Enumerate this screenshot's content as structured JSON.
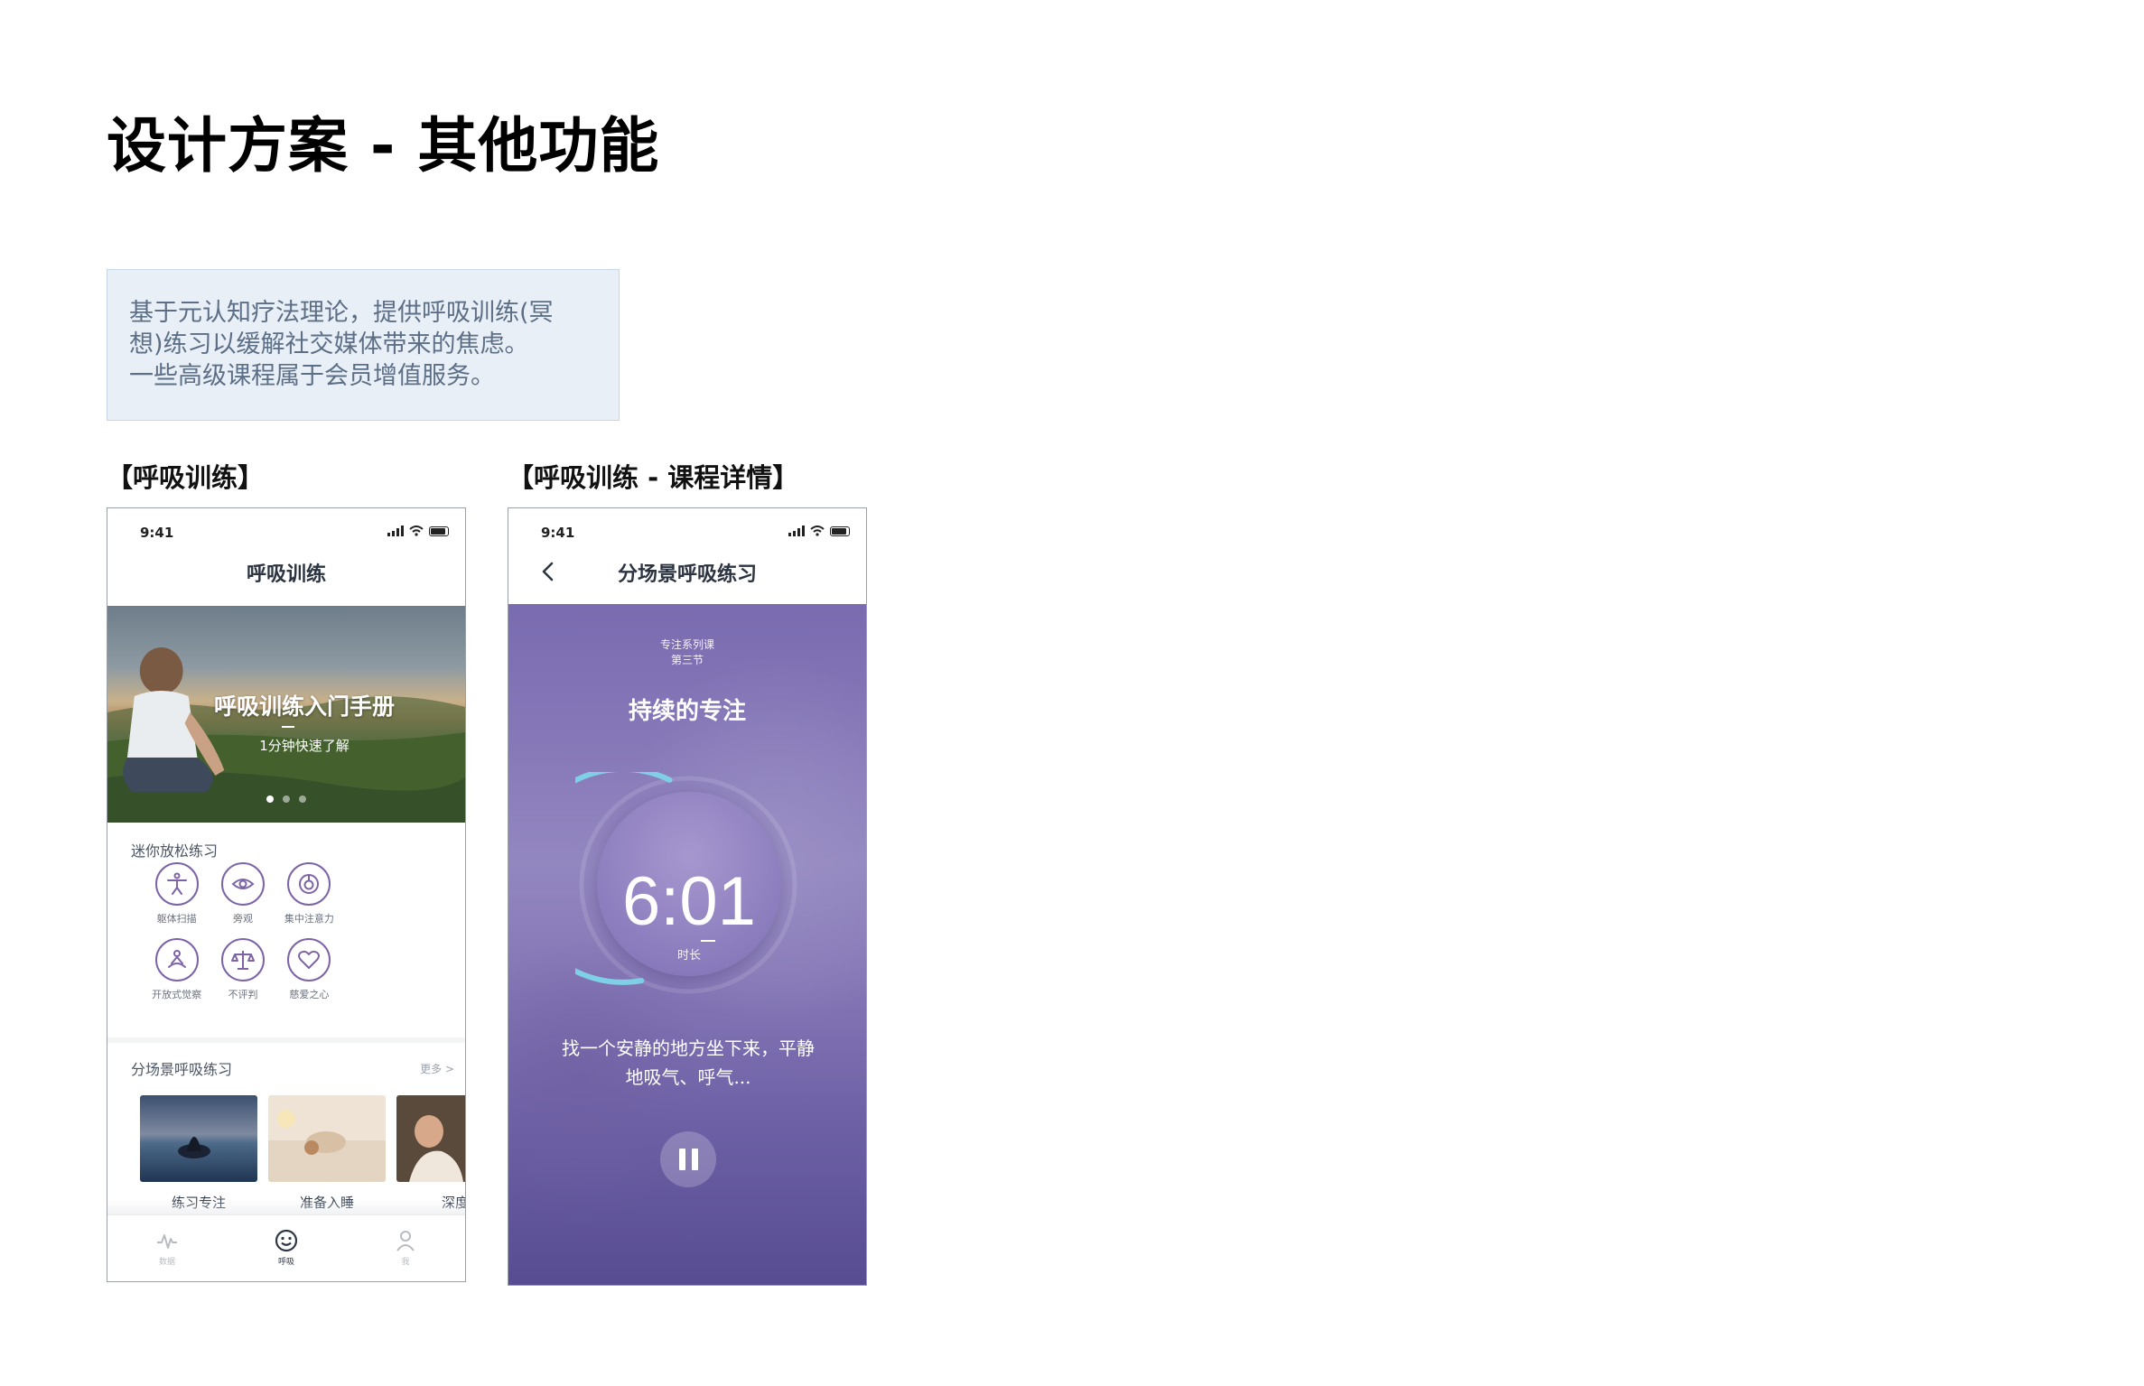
{
  "page": {
    "title": "设计方案 - 其他功能",
    "description": [
      "基于元认知疗法理论，提供呼吸训练(冥",
      "想)练习以缓解社交媒体带来的焦虑。",
      "一些高级课程属于会员增值服务。"
    ]
  },
  "labels": {
    "screen_a": "【呼吸训练】",
    "screen_b": "【呼吸训练 - 课程详情】"
  },
  "screen_a": {
    "status_time": "9:41",
    "nav_title": "呼吸训练",
    "banner": {
      "title": "呼吸训练入门手册",
      "subtitle": "1分钟快速了解"
    },
    "mini_section_title": "迷你放松练习",
    "mini_items": [
      {
        "label": "躯体扫描",
        "icon": "body-scan-icon"
      },
      {
        "label": "旁观",
        "icon": "eye-icon"
      },
      {
        "label": "集中注意力",
        "icon": "focus-target-icon"
      },
      {
        "label": "开放式觉察",
        "icon": "open-awareness-icon"
      },
      {
        "label": "不评判",
        "icon": "balance-scale-icon"
      },
      {
        "label": "慈爱之心",
        "icon": "heart-icon"
      }
    ],
    "scene_section_title": "分场景呼吸练习",
    "more_label": "更多 >",
    "scene_cards": [
      {
        "label": "练习专注"
      },
      {
        "label": "准备入睡"
      },
      {
        "label": "深度"
      }
    ],
    "tabs": [
      {
        "label": "数据",
        "icon": "pulse-icon"
      },
      {
        "label": "呼吸",
        "icon": "smile-icon"
      },
      {
        "label": "我",
        "icon": "user-icon"
      }
    ],
    "active_tab": 1
  },
  "screen_b": {
    "status_time": "9:41",
    "nav_title": "分场景呼吸练习",
    "course_series": "专注系列课",
    "course_lesson": "第三节",
    "course_title": "持续的专注",
    "timer_value": "6:01",
    "timer_label": "时长",
    "progress_fraction": 0.6,
    "instruction_lines": [
      "找一个安静的地方坐下来，平静",
      "地吸气、呼气..."
    ]
  },
  "colors": {
    "accent_purple": "#7d64a6",
    "timer_ring": "#7fd0e6",
    "player_gradient_top": "#7a6bb0",
    "player_gradient_bottom": "#574b92",
    "desc_box_bg": "#e9eff6"
  }
}
